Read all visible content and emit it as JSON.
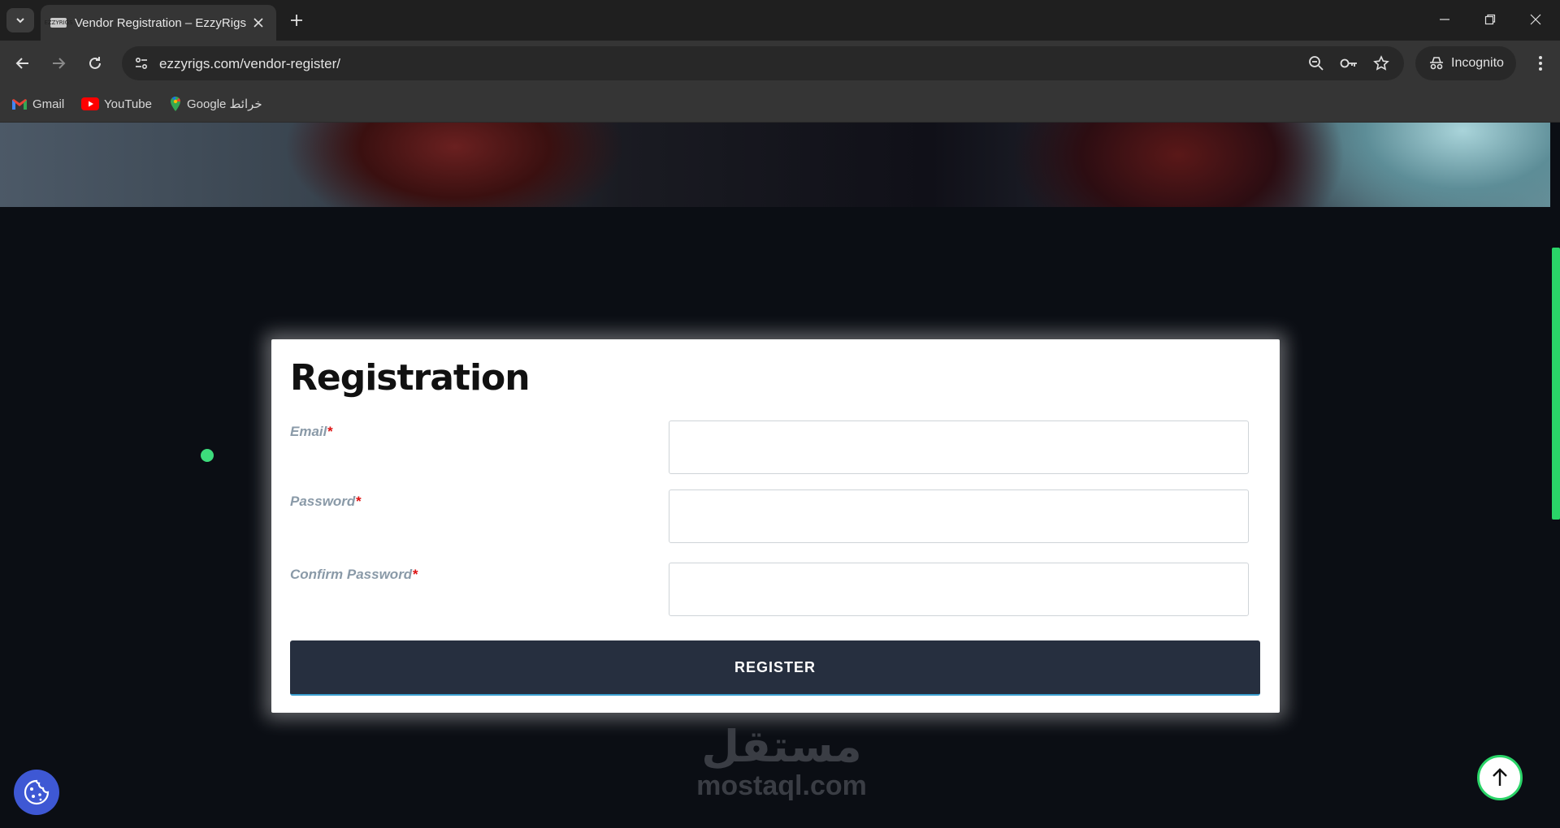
{
  "browser": {
    "tab": {
      "favicon_text": "EZZYRIGS",
      "title": "Vendor Registration – EzzyRigs"
    },
    "address": {
      "url": "ezzyrigs.com/vendor-register/"
    },
    "incognito_label": "Incognito",
    "bookmarks": [
      {
        "label": "Gmail",
        "icon": "gmail-icon"
      },
      {
        "label": "YouTube",
        "icon": "youtube-icon"
      },
      {
        "label": "Google خرائط",
        "icon": "google-maps-icon"
      }
    ]
  },
  "form": {
    "title": "Registration",
    "fields": [
      {
        "label": "Email",
        "required_mark": "*",
        "value": ""
      },
      {
        "label": "Password",
        "required_mark": "*",
        "value": ""
      },
      {
        "label": "Confirm Password",
        "required_mark": "*",
        "value": ""
      }
    ],
    "submit_label": "REGISTER"
  },
  "watermark": {
    "arabic": "مستقل",
    "latin": "mostaql.com"
  },
  "colors": {
    "accent_green": "#2ad468",
    "button_bg": "#262f3f",
    "cookie_blue": "#3e58d4"
  }
}
